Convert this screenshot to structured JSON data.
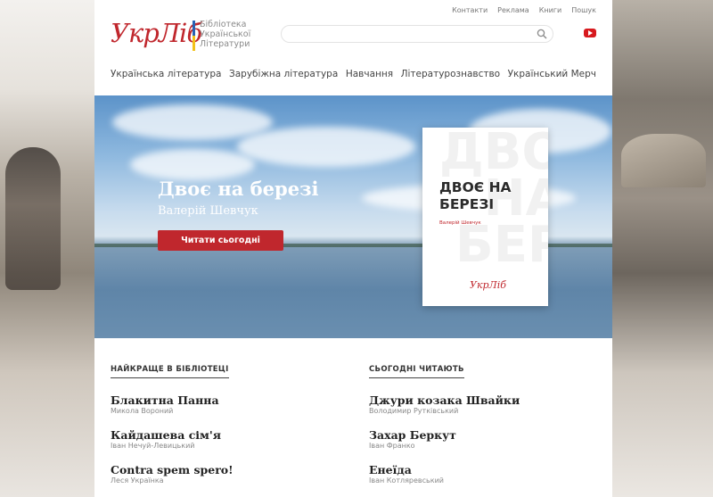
{
  "header": {
    "logo": "УкрЛіб",
    "logo_sub": [
      "Бібліотека",
      "Української",
      "Літератури"
    ],
    "top_links": [
      "Контакти",
      "Реклама",
      "Книги",
      "Пошук"
    ],
    "search_placeholder": ""
  },
  "nav": {
    "items": [
      "Українська література",
      "Зарубіжна література",
      "Навчання",
      "Літературознавство",
      "Український Мерч"
    ]
  },
  "hero": {
    "title": "Двоє на березі",
    "author": "Валерій Шевчук",
    "button": "Читати сьогодні",
    "book": {
      "title": "ДВОЄ НА БЕРЕЗІ",
      "author": "Валерій Шевчук",
      "logo": "УкрЛіб",
      "bg_text": "ДВО\nНА\nБЕР"
    }
  },
  "best": {
    "heading": "НАЙКРАЩЕ В БІБЛІОТЕЦІ",
    "items": [
      {
        "title": "Блакитна Панна",
        "author": "Микола Вороний"
      },
      {
        "title": "Кайдашева сім'я",
        "author": "Іван Нечуй-Левицький"
      },
      {
        "title": "Contra spem spero!",
        "author": "Леся Українка"
      }
    ]
  },
  "today": {
    "heading": "СЬОГОДНІ ЧИТАЮТЬ",
    "items": [
      {
        "title": "Джури козака Швайки",
        "author": "Володимир Рутківський"
      },
      {
        "title": "Захар Беркут",
        "author": "Іван Франко"
      },
      {
        "title": "Енеїда",
        "author": "Іван Котляревський"
      }
    ]
  },
  "colors": {
    "brand_red": "#c0272d",
    "sky_blue": "#5c93c9"
  }
}
